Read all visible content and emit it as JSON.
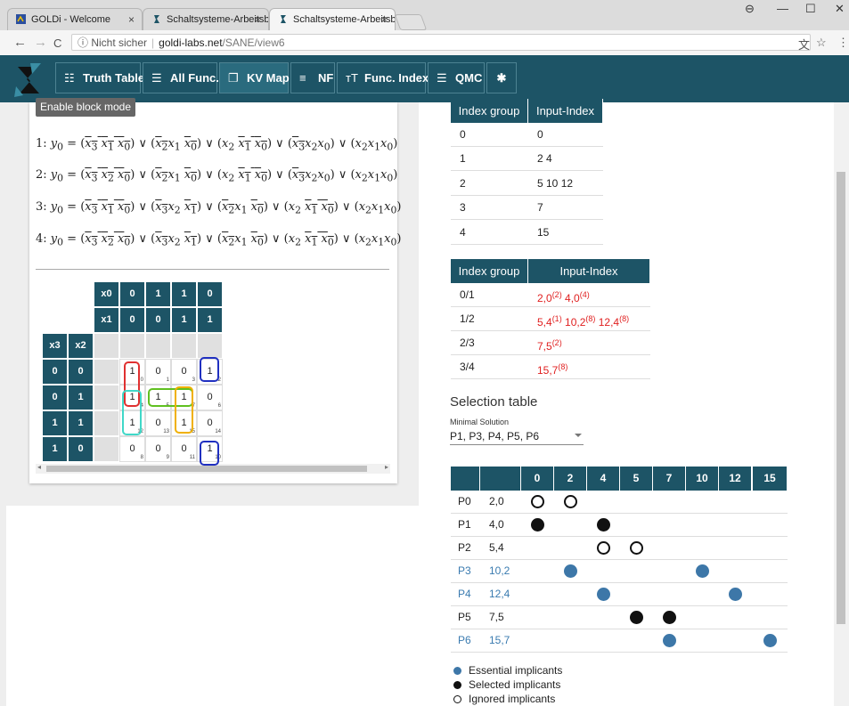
{
  "browser": {
    "tabs": [
      {
        "title": "GOLDi - Welcome",
        "close": "×"
      },
      {
        "title": "Schaltsysteme-Arbeitsblä",
        "close": "×"
      },
      {
        "title": "Schaltsysteme-Arbeitsblä",
        "close": "×"
      }
    ],
    "window_controls": {
      "profile": "⊖",
      "minimize": "—",
      "maximize": "☐",
      "close": "✕"
    },
    "nav": {
      "back": "←",
      "forward": "→",
      "reload": "C"
    },
    "address": {
      "security": "ⓘ Nicht sicher",
      "sep": "|",
      "host": "goldi-labs.net",
      "path": "/SANE/view6"
    },
    "right_icons": {
      "translate": "文",
      "star": "☆",
      "menu": "⋮"
    }
  },
  "appnav": {
    "items": [
      {
        "label": "Truth Table",
        "icon": "table-icon",
        "glyph": "☷"
      },
      {
        "label": "All Func.",
        "icon": "list-icon",
        "glyph": "☰"
      },
      {
        "label": "KV Map",
        "icon": "square-icon",
        "glyph": "❐"
      },
      {
        "label": "NF",
        "icon": "lines-icon",
        "glyph": "≡"
      },
      {
        "label": "Func. Index",
        "icon": "tt-icon",
        "glyph": "ᴛT"
      },
      {
        "label": "QMC",
        "icon": "qmc-icon",
        "glyph": "☰"
      }
    ],
    "settings_glyph": "✱"
  },
  "left": {
    "block_mode_button": "Enable block mode",
    "equations": [
      {
        "num": "1:"
      },
      {
        "num": "2:"
      },
      {
        "num": "3:"
      },
      {
        "num": "4:"
      }
    ],
    "kv": {
      "col_vars": [
        "x0",
        "x1"
      ],
      "row_vars": [
        "x3",
        "x2"
      ],
      "col_x0": [
        "0",
        "1",
        "1",
        "0"
      ],
      "col_x1": [
        "0",
        "0",
        "1",
        "1"
      ],
      "row_x3": [
        "0",
        "0",
        "1",
        "1"
      ],
      "row_x2": [
        "0",
        "1",
        "1",
        "0"
      ],
      "cells": [
        [
          {
            "v": "1",
            "i": "0"
          },
          {
            "v": "0",
            "i": "1"
          },
          {
            "v": "0",
            "i": "3"
          },
          {
            "v": "1",
            "i": "2"
          }
        ],
        [
          {
            "v": "1",
            "i": "4"
          },
          {
            "v": "1",
            "i": "5"
          },
          {
            "v": "1",
            "i": "7"
          },
          {
            "v": "0",
            "i": "6"
          }
        ],
        [
          {
            "v": "1",
            "i": "12"
          },
          {
            "v": "0",
            "i": "13"
          },
          {
            "v": "1",
            "i": "15"
          },
          {
            "v": "0",
            "i": "14"
          }
        ],
        [
          {
            "v": "0",
            "i": "8"
          },
          {
            "v": "0",
            "i": "9"
          },
          {
            "v": "0",
            "i": "11"
          },
          {
            "v": "1",
            "i": "10"
          }
        ]
      ]
    },
    "hscroll": {
      "left": "◂",
      "right": "▸"
    }
  },
  "right": {
    "table1": {
      "headers": [
        "Index group",
        "Input-Index"
      ],
      "rows": [
        [
          "0",
          "0"
        ],
        [
          "1",
          "2  4"
        ],
        [
          "2",
          "5  10  12"
        ],
        [
          "3",
          "7"
        ],
        [
          "4",
          "15"
        ]
      ]
    },
    "table2": {
      "headers": [
        "Index group",
        "Input-Index"
      ],
      "rows": [
        {
          "group": "0/1",
          "items": [
            {
              "t": "2,0",
              "s": "(2)"
            },
            {
              "t": "4,0",
              "s": "(4)"
            }
          ]
        },
        {
          "group": "1/2",
          "items": [
            {
              "t": "5,4",
              "s": "(1)"
            },
            {
              "t": "10,2",
              "s": "(8)"
            },
            {
              "t": "12,4",
              "s": "(8)"
            }
          ]
        },
        {
          "group": "2/3",
          "items": [
            {
              "t": "7,5",
              "s": "(2)"
            }
          ]
        },
        {
          "group": "3/4",
          "items": [
            {
              "t": "15,7",
              "s": "(8)"
            }
          ]
        }
      ]
    },
    "selection": {
      "title": "Selection table",
      "minimal_label": "Minimal Solution",
      "minimal_value": "P1, P3, P4, P5, P6",
      "columns": [
        "0",
        "2",
        "4",
        "5",
        "7",
        "10",
        "12",
        "15"
      ],
      "rows": [
        {
          "p": "P0",
          "v": "2,0",
          "essential": false,
          "marks": {
            "0": "i",
            "2": "i"
          }
        },
        {
          "p": "P1",
          "v": "4,0",
          "essential": false,
          "marks": {
            "0": "s",
            "4": "s"
          }
        },
        {
          "p": "P2",
          "v": "5,4",
          "essential": false,
          "marks": {
            "4": "i",
            "5": "i"
          }
        },
        {
          "p": "P3",
          "v": "10,2",
          "essential": true,
          "marks": {
            "2": "e",
            "10": "e"
          }
        },
        {
          "p": "P4",
          "v": "12,4",
          "essential": true,
          "marks": {
            "4": "e",
            "12": "e"
          }
        },
        {
          "p": "P5",
          "v": "7,5",
          "essential": false,
          "marks": {
            "5": "s",
            "7": "s"
          }
        },
        {
          "p": "P6",
          "v": "15,7",
          "essential": true,
          "marks": {
            "7": "e",
            "15": "e"
          }
        }
      ],
      "legend": [
        {
          "label": "Essential implicants",
          "kind": "e"
        },
        {
          "label": "Selected implicants",
          "kind": "s"
        },
        {
          "label": "Ignored implicants",
          "kind": "i"
        }
      ]
    }
  },
  "colors": {
    "nav_bg": "#1d5466",
    "essential": "#3d77a8",
    "red": "#e02020"
  }
}
